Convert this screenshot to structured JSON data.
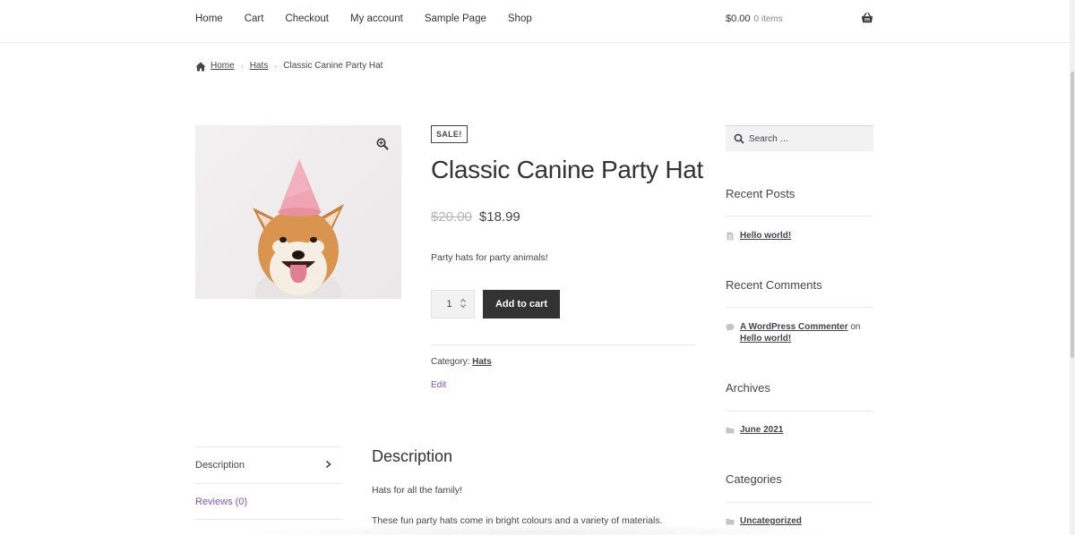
{
  "nav": {
    "items": [
      "Home",
      "Cart",
      "Checkout",
      "My account",
      "Sample Page",
      "Shop"
    ]
  },
  "cart": {
    "total": "$0.00",
    "count": "0 items"
  },
  "breadcrumb": {
    "home": "Home",
    "category": "Hats",
    "current": "Classic Canine Party Hat"
  },
  "product": {
    "sale_badge": "SALE!",
    "title": "Classic Canine Party Hat",
    "old_price": "$20.00",
    "new_price": "$18.99",
    "short_description": "Party hats for party animals!",
    "quantity": "1",
    "add_to_cart": "Add to cart",
    "category_label": "Category:",
    "category": "Hats",
    "edit": "Edit"
  },
  "tabs": {
    "description": "Description",
    "reviews": "Reviews (0)"
  },
  "panel": {
    "title": "Description",
    "p1": "Hats for all the family!",
    "p2": "These fun party hats come in bright colours and a variety of materials."
  },
  "sidebar": {
    "search_placeholder": "Search …",
    "recent_posts_title": "Recent Posts",
    "recent_post": "Hello world!",
    "recent_comments_title": "Recent Comments",
    "commenter": "A WordPress Commenter",
    "comment_on": "on",
    "comment_post": "Hello world!",
    "archives_title": "Archives",
    "archive": "June 2021",
    "categories_title": "Categories",
    "category": "Uncategorized"
  },
  "colors": {
    "accent": "#7f54b3",
    "button": "#333333",
    "text": "#43454b"
  }
}
